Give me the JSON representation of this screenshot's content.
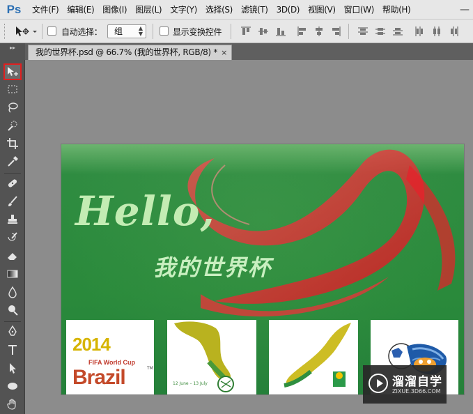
{
  "app": {
    "logo": "Ps"
  },
  "menu": {
    "items": [
      "文件(F)",
      "编辑(E)",
      "图像(I)",
      "图层(L)",
      "文字(Y)",
      "选择(S)",
      "滤镜(T)",
      "3D(D)",
      "视图(V)",
      "窗口(W)",
      "帮助(H)"
    ],
    "minimize_glyph": "—"
  },
  "options": {
    "auto_select_label": "自动选择：",
    "auto_select_checked": false,
    "auto_select_value": "组",
    "show_transform_label": "显示变换控件",
    "show_transform_checked": false
  },
  "document": {
    "tab_title": "我的世界杯.psd @ 66.7% (我的世界杯, RGB/8) *",
    "close_glyph": "×"
  },
  "toolbox": {
    "expand_glyph": "▸▸",
    "active_tool": "move-tool",
    "tools": [
      "move-tool",
      "rectangular-marquee-tool",
      "lasso-tool",
      "quick-selection-tool",
      "crop-tool",
      "eyedropper-tool",
      "healing-brush-tool",
      "brush-tool",
      "clone-stamp-tool",
      "history-brush-tool",
      "eraser-tool",
      "gradient-tool",
      "blur-tool",
      "dodge-tool",
      "pen-tool",
      "type-tool",
      "path-selection-tool",
      "ellipse-tool",
      "hand-tool"
    ]
  },
  "canvas": {
    "headline": "Hello,",
    "subtitle": "我的世界杯",
    "poster1": {
      "year": "2014",
      "cup": "FIFA World Cup",
      "country": "Brazil",
      "tm": "TM"
    },
    "poster2": {
      "date": "12 June – 13 July"
    }
  },
  "watermark": {
    "title": "溜溜自学",
    "url": "ZIXUE.3D66.COM"
  },
  "colors": {
    "menubar": "#e7e7e7",
    "toolbox": "#535353",
    "workspace": "#8c8c8c",
    "grass": "#2e8a3e",
    "ribbon": "#e8202a",
    "active_tool_outline": "#e02020",
    "ps_blue": "#2b6fb3"
  }
}
